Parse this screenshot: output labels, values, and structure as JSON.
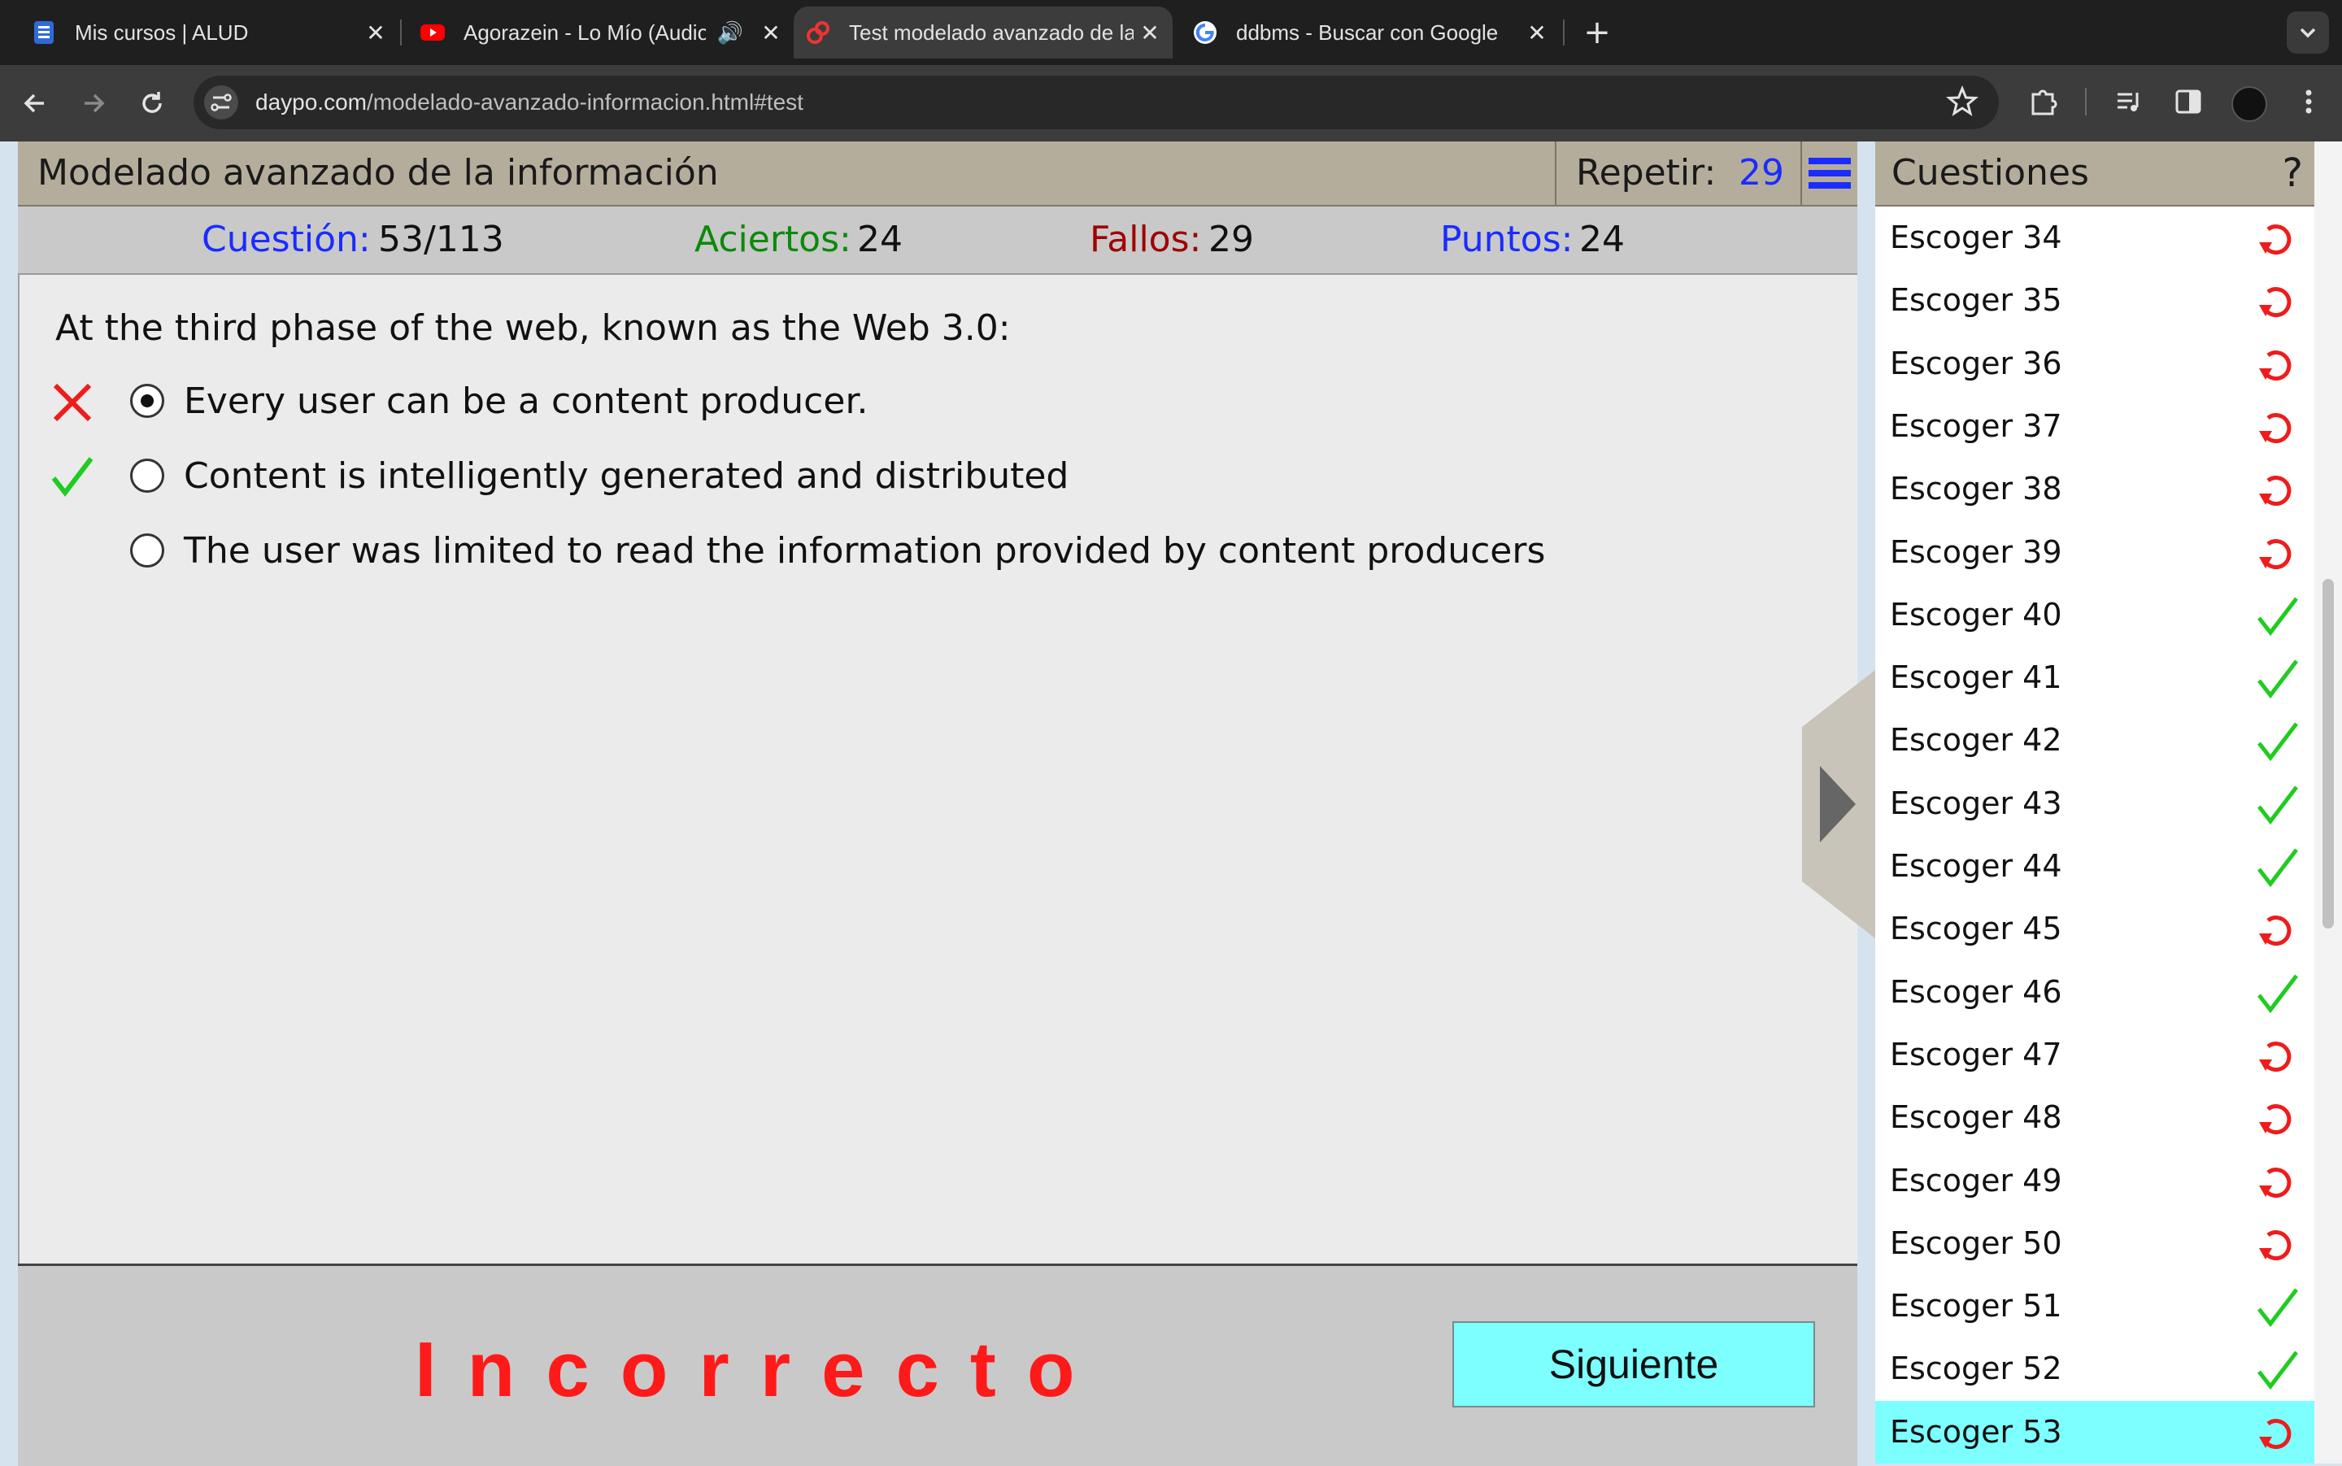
{
  "browser": {
    "tabs": [
      {
        "title": "Mis cursos | ALUD",
        "favicon": "alud-favicon",
        "active": false
      },
      {
        "title": "Agorazein - Lo Mío (Audio",
        "favicon": "youtube-favicon",
        "active": false,
        "audio": true
      },
      {
        "title": "Test modelado avanzado de la",
        "favicon": "daypo-favicon",
        "active": true
      },
      {
        "title": "ddbms - Buscar con Google",
        "favicon": "google-favicon",
        "active": false
      }
    ],
    "url_host": "daypo.com",
    "url_path": "/modelado-avanzado-informacion.html#test",
    "icons": [
      "back-icon",
      "forward-icon",
      "reload-icon",
      "site-info-icon",
      "star-icon",
      "extensions-icon",
      "media-icon",
      "sidepanel-icon",
      "profile-icon",
      "kebab-menu-icon"
    ]
  },
  "test": {
    "title": "Modelado avanzado de la información",
    "repeat_label": "Repetir:",
    "repeat_value": "29",
    "stats": {
      "question_label": "Cuestión:",
      "question_value": "53/113",
      "correct_label": "Aciertos:",
      "correct_value": "24",
      "fail_label": "Fallos:",
      "fail_value": "29",
      "points_label": "Puntos:",
      "points_value": "24"
    },
    "question": "At the third phase of the web, known as the Web 3.0:",
    "options": [
      {
        "text": "Every user can be a content producer.",
        "selected": true,
        "mark": "cross"
      },
      {
        "text": "Content is intelligently generated and distributed",
        "selected": false,
        "mark": "check"
      },
      {
        "text": "The user was limited to read the information provided by content producers",
        "selected": false,
        "mark": "none"
      }
    ],
    "result": "Incorrecto",
    "next_button": "Siguiente"
  },
  "colors": {
    "blue_label": "#1a2cff",
    "green_label": "#0a8a0a",
    "red_label": "#a00000",
    "result_red": "#ff1a1a",
    "check_green": "#1fcc1f",
    "retry_red": "#ee1c1c",
    "highlight": "#7dffff",
    "header_bg": "#b5ad9c"
  },
  "sidebar": {
    "title": "Cuestiones",
    "help": "?",
    "items": [
      {
        "label": "Escoger 34",
        "status": "retry"
      },
      {
        "label": "Escoger 35",
        "status": "retry"
      },
      {
        "label": "Escoger 36",
        "status": "retry"
      },
      {
        "label": "Escoger 37",
        "status": "retry"
      },
      {
        "label": "Escoger 38",
        "status": "retry"
      },
      {
        "label": "Escoger 39",
        "status": "retry"
      },
      {
        "label": "Escoger 40",
        "status": "correct"
      },
      {
        "label": "Escoger 41",
        "status": "correct"
      },
      {
        "label": "Escoger 42",
        "status": "correct"
      },
      {
        "label": "Escoger 43",
        "status": "correct"
      },
      {
        "label": "Escoger 44",
        "status": "correct"
      },
      {
        "label": "Escoger 45",
        "status": "retry"
      },
      {
        "label": "Escoger 46",
        "status": "correct"
      },
      {
        "label": "Escoger 47",
        "status": "retry"
      },
      {
        "label": "Escoger 48",
        "status": "retry"
      },
      {
        "label": "Escoger 49",
        "status": "retry"
      },
      {
        "label": "Escoger 50",
        "status": "retry"
      },
      {
        "label": "Escoger 51",
        "status": "correct"
      },
      {
        "label": "Escoger 52",
        "status": "correct"
      },
      {
        "label": "Escoger 53",
        "status": "retry",
        "current": true
      }
    ]
  }
}
